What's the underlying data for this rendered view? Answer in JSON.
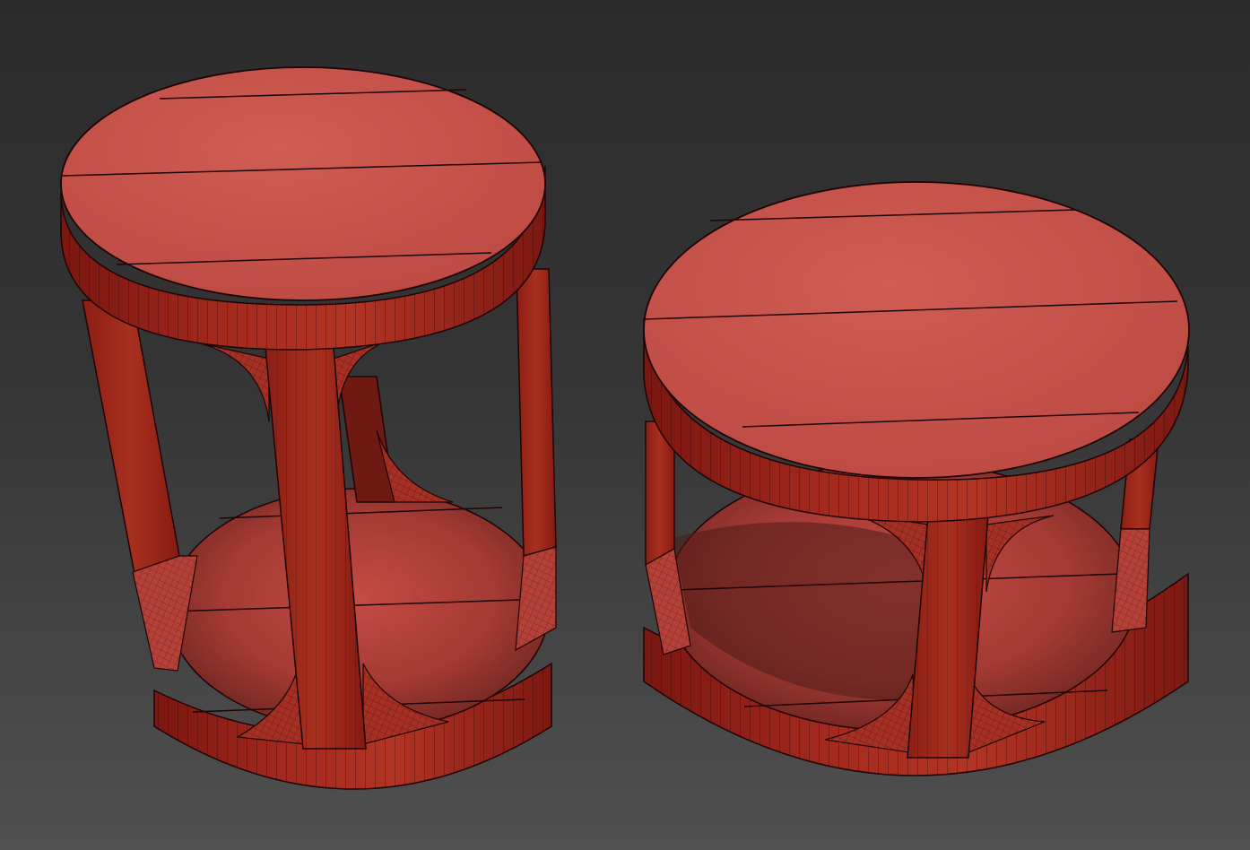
{
  "viewport": {
    "shading": "wireframe-over-solid",
    "background": {
      "top": "#2b2b2b",
      "bottom": "#505050"
    }
  },
  "colors": {
    "top_face": "#c4504a",
    "top_face_light": "#cc5a50",
    "side_dark": "#8a1c14",
    "side_mid": "#a2281c",
    "side_light": "#b8382c",
    "inner_dark": "#5e241e",
    "edge": "#1e0404",
    "highlight": "#d2605a"
  },
  "objects": [
    {
      "name": "tall-side-table",
      "plank_count": 3,
      "leg_count": 4
    },
    {
      "name": "short-side-table",
      "plank_count": 3,
      "leg_count": 4
    }
  ]
}
